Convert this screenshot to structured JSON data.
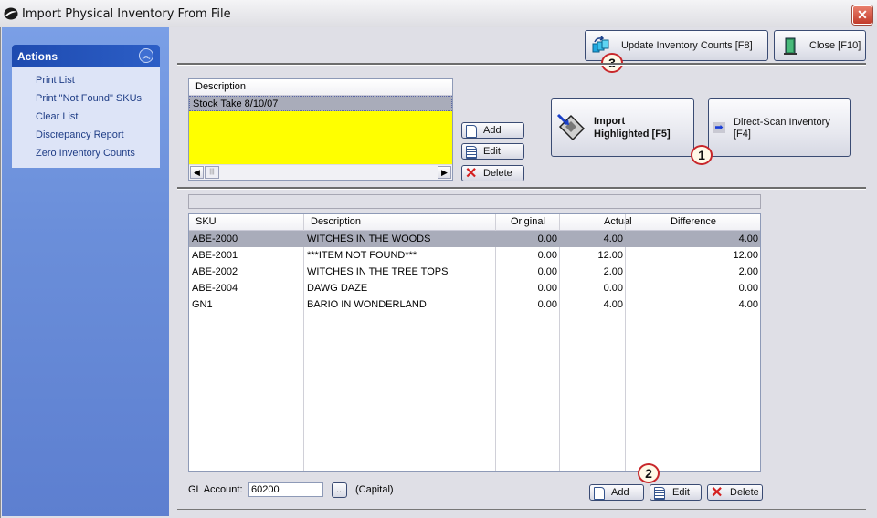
{
  "window": {
    "title": "Import Physical Inventory From File",
    "close_icon": "close-x-icon",
    "app_icon": "app-logo-icon"
  },
  "sidebar": {
    "panel_title": "Actions",
    "collapse_icon": "double-chevron-up-icon",
    "items": [
      {
        "label": "Print List"
      },
      {
        "label": "Print \"Not Found\" SKUs"
      },
      {
        "label": "Clear List"
      },
      {
        "label": "Discrepancy Report"
      },
      {
        "label": "Zero Inventory Counts"
      }
    ]
  },
  "toolbar": {
    "update_label": "Update Inventory Counts [F8]",
    "update_icon": "update-counts-icon",
    "close_label": "Close [F10]",
    "close_icon": "door-exit-icon"
  },
  "files": {
    "header": "Description",
    "rows": [
      {
        "description": "Stock Take 8/10/07"
      }
    ],
    "highlight_color": "#ffff00",
    "add_label": "Add",
    "edit_label": "Edit",
    "delete_label": "Delete"
  },
  "actions": {
    "import_line1": "Import",
    "import_line2": "Highlighted [F5]",
    "import_icon": "floppy-disk-import-icon",
    "scan_line1": "Direct-Scan Inventory",
    "scan_line2": "[F4]",
    "scan_icon": "blue-arrow-right-icon"
  },
  "items": {
    "columns": [
      "SKU",
      "Description",
      "Original",
      "Actual",
      "Difference"
    ],
    "rows": [
      {
        "sku": "ABE-2000",
        "description": "WITCHES IN THE WOODS",
        "original": "0.00",
        "actual": "4.00",
        "difference": "4.00",
        "selected": true
      },
      {
        "sku": "ABE-2001",
        "description": "***ITEM NOT FOUND***",
        "original": "0.00",
        "actual": "12.00",
        "difference": "12.00"
      },
      {
        "sku": "ABE-2002",
        "description": "WITCHES IN THE TREE TOPS",
        "original": "0.00",
        "actual": "2.00",
        "difference": "2.00"
      },
      {
        "sku": "ABE-2004",
        "description": "DAWG DAZE",
        "original": "0.00",
        "actual": "0.00",
        "difference": "0.00"
      },
      {
        "sku": "GN1",
        "description": "BARIO IN WONDERLAND",
        "original": "0.00",
        "actual": "4.00",
        "difference": "4.00"
      }
    ],
    "add_label": "Add",
    "edit_label": "Edit",
    "delete_label": "Delete"
  },
  "gl": {
    "label": "GL Account:",
    "value": "60200",
    "browse_label": "...",
    "account_name": "(Capital)"
  },
  "callouts": [
    "1",
    "2",
    "3"
  ]
}
